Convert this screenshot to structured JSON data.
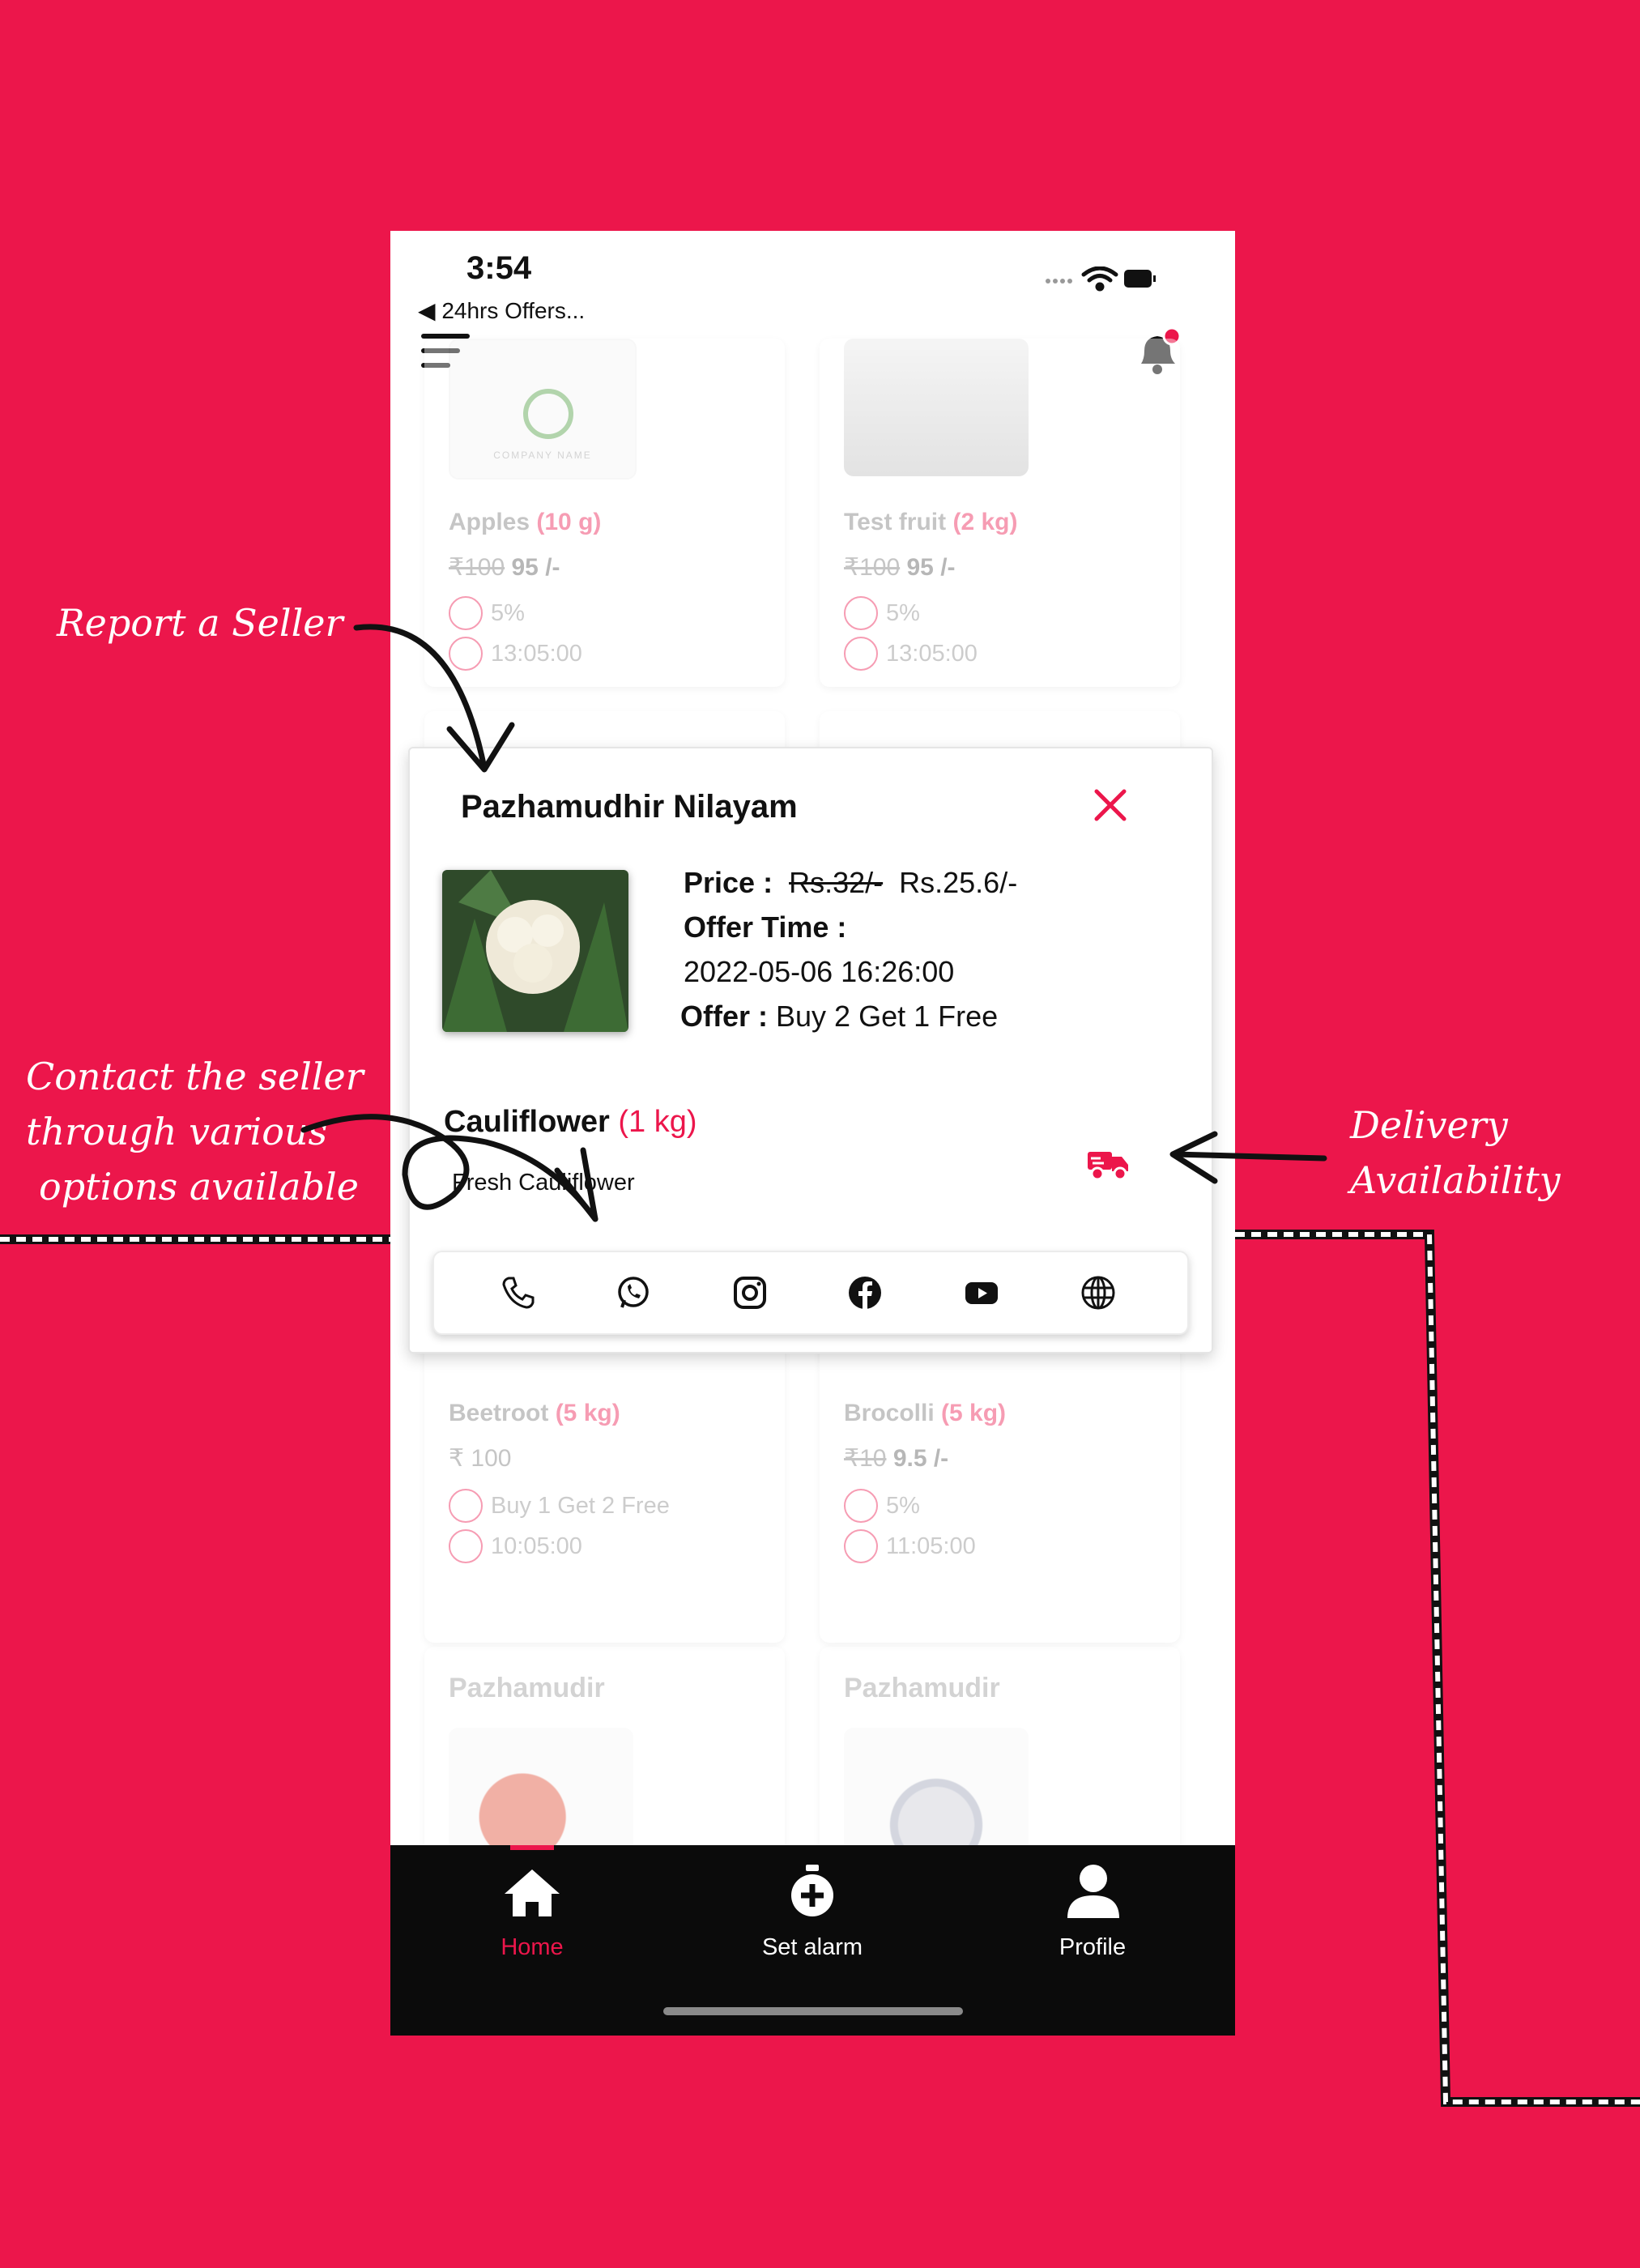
{
  "annotations": {
    "report_seller": "Report a Seller",
    "contact_line1": "Contact the seller",
    "contact_line2": "through various",
    "contact_line3": "options available",
    "delivery_line1": "Delivery",
    "delivery_line2": "Availability"
  },
  "status_bar": {
    "time": "3:54",
    "back_label": "◀ 24hrs Offers..."
  },
  "colors": {
    "brand": "#EC164B",
    "tabbar": "#0b0b0b"
  },
  "cards": [
    {
      "name": "Apples",
      "qty": "(10 g)",
      "old_price": "₹100",
      "new_price": "95 /-",
      "offer": "5%",
      "time": "13:05:00",
      "logo_text": "COMPANY NAME"
    },
    {
      "name": "Test fruit",
      "qty": "(2 kg)",
      "old_price": "₹100",
      "new_price": "95 /-",
      "offer": "5%",
      "time": "13:05:00"
    },
    {
      "name": "Beetroot",
      "qty": "(5 kg)",
      "price": "₹ 100",
      "offer": "Buy 1 Get 2 Free",
      "time": "10:05:00"
    },
    {
      "name": "Brocolli",
      "qty": "(5 kg)",
      "old_price": "₹10",
      "new_price": "9.5 /-",
      "offer": "5%",
      "time": "11:05:00"
    },
    {
      "seller": "Pazhamudir"
    },
    {
      "seller": "Pazhamudir"
    }
  ],
  "modal": {
    "seller_name": "Pazhamudhir Nilayam",
    "price_label": "Price :",
    "old_price": "Rs.32/-",
    "new_price": "Rs.25.6/-",
    "offer_time_label": "Offer Time :",
    "offer_time": "2022-05-06 16:26:00",
    "offer_label": "Offer :",
    "offer": "Buy 2 Get 1 Free",
    "product_name": "Cauliflower",
    "product_qty": "(1 kg)",
    "product_desc": "Fresh Cauliflower",
    "contact_icons": [
      "phone-icon",
      "whatsapp-icon",
      "instagram-icon",
      "facebook-icon",
      "youtube-icon",
      "globe-icon"
    ]
  },
  "tabs": [
    {
      "label": "Home",
      "icon": "home-icon",
      "active": true
    },
    {
      "label": "Set alarm",
      "icon": "stopwatch-icon",
      "active": false
    },
    {
      "label": "Profile",
      "icon": "user-icon",
      "active": false
    }
  ]
}
